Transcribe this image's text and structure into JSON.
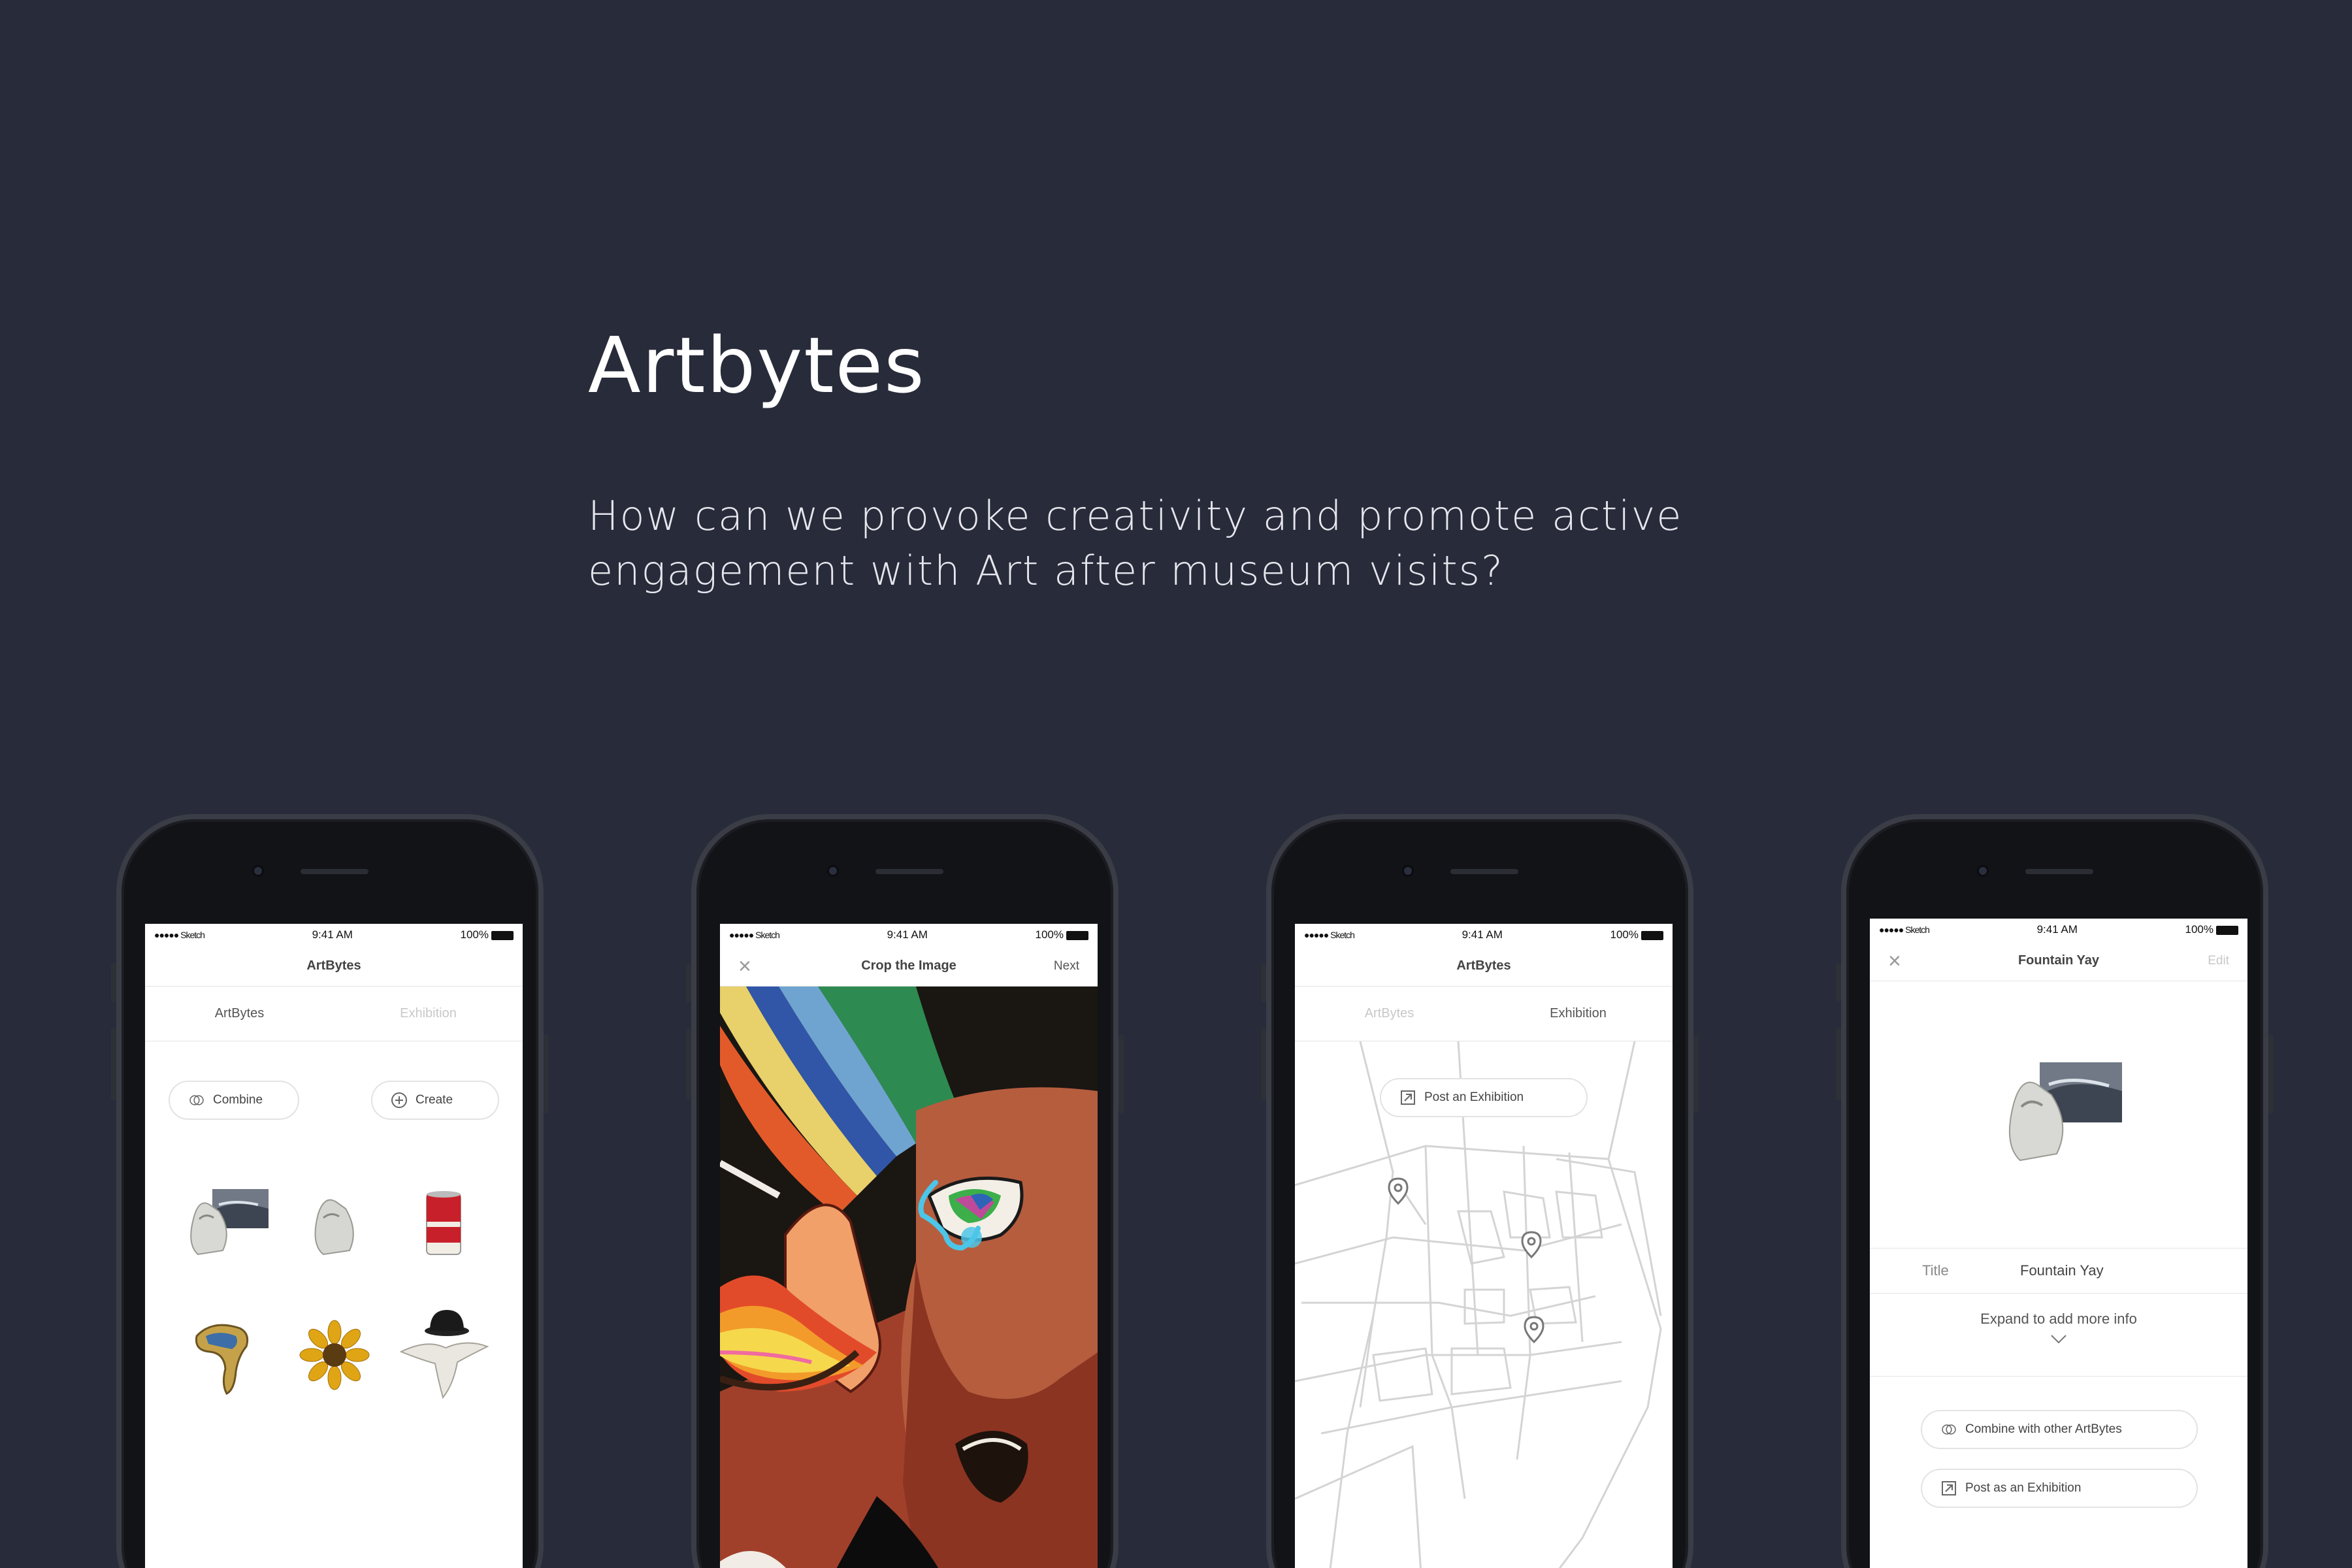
{
  "page": {
    "title": "Artbytes",
    "subtitle": "How can we provoke creativity and promote active engagement with Art after museum visits?"
  },
  "status": {
    "carrier": "●●●●● Sketch",
    "time": "9:41 AM",
    "battery": "100%"
  },
  "phone1": {
    "nav_title": "ArtBytes",
    "tabs": [
      "ArtBytes",
      "Exhibition"
    ],
    "combine_label": "Combine",
    "create_label": "Create",
    "items": [
      "fountain-collage",
      "fountain",
      "soup-can",
      "melting-watch",
      "sunflower",
      "hat-dove"
    ]
  },
  "phone2": {
    "nav_title": "Crop the Image",
    "next_label": "Next"
  },
  "phone3": {
    "nav_title": "ArtBytes",
    "tabs": [
      "ArtBytes",
      "Exhibition"
    ],
    "post_label": "Post an Exhibition"
  },
  "phone4": {
    "nav_title": "Fountain Yay",
    "edit_label": "Edit",
    "title_label": "Title",
    "title_value": "Fountain Yay",
    "expand_label": "Expand to add more info",
    "combine_label": "Combine with other ArtBytes",
    "post_label": "Post as an Exhibition"
  },
  "colors": {
    "background": "#282b39",
    "frame": "#121317",
    "screen": "#ffffff"
  }
}
